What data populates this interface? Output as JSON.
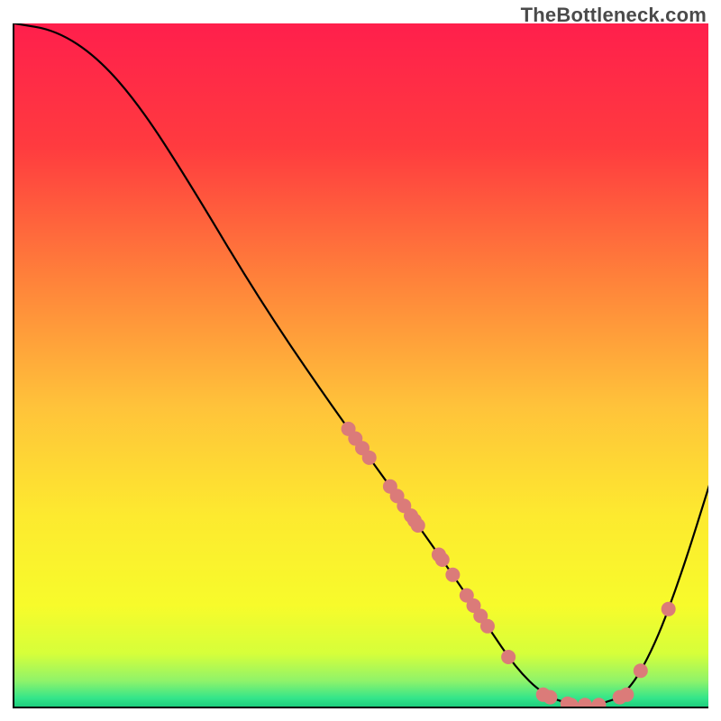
{
  "watermark": "TheBottleneck.com",
  "chart_data": {
    "type": "line",
    "title": "",
    "xlabel": "",
    "ylabel": "",
    "xlim": [
      0,
      100
    ],
    "ylim": [
      0,
      100
    ],
    "curve": [
      {
        "x": 0,
        "y": 100
      },
      {
        "x": 6,
        "y": 99
      },
      {
        "x": 12,
        "y": 95
      },
      {
        "x": 18,
        "y": 88
      },
      {
        "x": 25,
        "y": 77
      },
      {
        "x": 35,
        "y": 60
      },
      {
        "x": 45,
        "y": 45
      },
      {
        "x": 55,
        "y": 31
      },
      {
        "x": 62,
        "y": 21
      },
      {
        "x": 68,
        "y": 12
      },
      {
        "x": 72,
        "y": 6
      },
      {
        "x": 76,
        "y": 2
      },
      {
        "x": 80,
        "y": 0.5
      },
      {
        "x": 84,
        "y": 0.5
      },
      {
        "x": 88,
        "y": 2
      },
      {
        "x": 92,
        "y": 9
      },
      {
        "x": 96,
        "y": 20
      },
      {
        "x": 100,
        "y": 33
      }
    ],
    "points_on_curve_x": [
      48,
      49,
      50,
      51,
      54,
      55,
      56,
      57,
      57.5,
      58,
      61,
      61.5,
      63,
      65,
      66,
      67,
      68,
      71,
      76,
      77,
      79.5,
      80,
      82,
      84,
      87,
      88,
      90,
      94
    ],
    "point_color": "#db7b79",
    "point_radius": 8,
    "gradient_stops": [
      {
        "offset": 0.0,
        "color": "#ff1f4c"
      },
      {
        "offset": 0.18,
        "color": "#ff3b3f"
      },
      {
        "offset": 0.38,
        "color": "#ff843a"
      },
      {
        "offset": 0.56,
        "color": "#ffc33a"
      },
      {
        "offset": 0.72,
        "color": "#fdea2f"
      },
      {
        "offset": 0.85,
        "color": "#f7fb2b"
      },
      {
        "offset": 0.92,
        "color": "#d6ff3a"
      },
      {
        "offset": 0.96,
        "color": "#8ff36a"
      },
      {
        "offset": 0.985,
        "color": "#34e58a"
      },
      {
        "offset": 1.0,
        "color": "#18c97b"
      }
    ]
  }
}
